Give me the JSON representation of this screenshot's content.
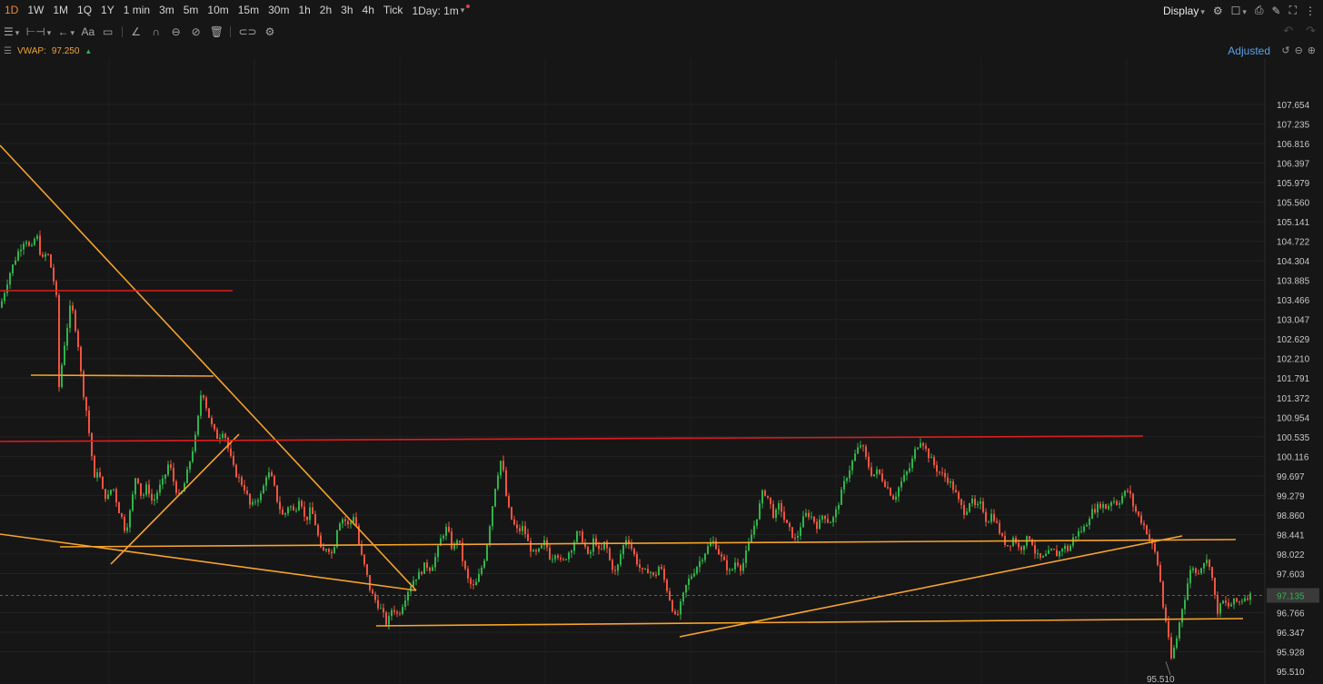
{
  "toolbar": {
    "timeframes": [
      "1D",
      "1W",
      "1M",
      "1Q",
      "1Y",
      "1 min",
      "3m",
      "5m",
      "10m",
      "15m",
      "30m",
      "1h",
      "2h",
      "3h",
      "4h",
      "Tick"
    ],
    "active_timeframe": "1D",
    "range_selector": "1Day: 1m",
    "display_label": "Display"
  },
  "drawing_tools": [
    "menu-icon",
    "measure-icon",
    "arrow-icon",
    "text-icon",
    "comment-icon",
    "line-icon",
    "magnet-icon",
    "ruler-icon",
    "eye-off-icon",
    "trash-icon",
    "link-icon",
    "settings-icon"
  ],
  "indicator": {
    "name": "VWAP:",
    "value": "97.250"
  },
  "price_mode": "Adjusted",
  "colors": {
    "up": "#2fb34a",
    "down": "#f0543e",
    "trend_orange": "#f6a32a",
    "resistance_red": "#e01c1c",
    "background": "#161616",
    "last_price": "#2fb34a"
  },
  "chart_data": {
    "type": "candlestick",
    "title": "",
    "xlabel": "",
    "ylabel": "",
    "ylim": [
      95.4,
      108.0
    ],
    "y_ticks": [
      "107.654",
      "107.235",
      "106.816",
      "106.397",
      "105.979",
      "105.560",
      "105.141",
      "104.722",
      "104.304",
      "103.885",
      "103.466",
      "103.047",
      "102.629",
      "102.210",
      "101.791",
      "101.372",
      "100.954",
      "100.535",
      "100.116",
      "99.697",
      "99.279",
      "98.860",
      "98.441",
      "98.022",
      "97.603",
      "97.135",
      "96.766",
      "96.347",
      "95.928",
      "95.510"
    ],
    "y_tick_values": [
      107.654,
      107.235,
      106.816,
      106.397,
      105.979,
      105.56,
      105.141,
      104.722,
      104.304,
      103.885,
      103.466,
      103.047,
      102.629,
      102.21,
      101.791,
      101.372,
      100.954,
      100.535,
      100.116,
      99.697,
      99.279,
      98.86,
      98.441,
      98.022,
      97.603,
      97.135,
      96.766,
      96.347,
      95.928,
      95.51
    ],
    "last_price": 97.135,
    "session_low": 95.51,
    "grid": true,
    "close_path": [
      [
        0,
        103.3
      ],
      [
        10,
        104.0
      ],
      [
        20,
        104.5
      ],
      [
        28,
        104.8
      ],
      [
        34,
        104.5
      ],
      [
        40,
        104.9
      ],
      [
        46,
        104.3
      ],
      [
        52,
        104.5
      ],
      [
        58,
        104.0
      ],
      [
        62,
        103.5
      ],
      [
        65,
        101.6
      ],
      [
        70,
        102.4
      ],
      [
        74,
        102.9
      ],
      [
        78,
        103.4
      ],
      [
        82,
        103.0
      ],
      [
        86,
        102.5
      ],
      [
        90,
        101.7
      ],
      [
        95,
        101.1
      ],
      [
        100,
        100.3
      ],
      [
        104,
        99.6
      ],
      [
        108,
        99.9
      ],
      [
        112,
        99.4
      ],
      [
        118,
        99.2
      ],
      [
        124,
        99.5
      ],
      [
        130,
        99.0
      ],
      [
        134,
        98.8
      ],
      [
        138,
        98.5
      ],
      [
        144,
        99.0
      ],
      [
        150,
        99.8
      ],
      [
        156,
        99.2
      ],
      [
        162,
        99.5
      ],
      [
        168,
        99.1
      ],
      [
        174,
        99.4
      ],
      [
        180,
        99.6
      ],
      [
        186,
        100.0
      ],
      [
        192,
        99.5
      ],
      [
        198,
        99.2
      ],
      [
        204,
        99.6
      ],
      [
        210,
        100.1
      ],
      [
        216,
        100.6
      ],
      [
        222,
        101.6
      ],
      [
        228,
        101.1
      ],
      [
        234,
        100.7
      ],
      [
        240,
        100.5
      ],
      [
        246,
        100.7
      ],
      [
        252,
        100.2
      ],
      [
        258,
        99.8
      ],
      [
        264,
        99.6
      ],
      [
        270,
        99.4
      ],
      [
        276,
        99.0
      ],
      [
        282,
        99.2
      ],
      [
        288,
        99.3
      ],
      [
        294,
        99.8
      ],
      [
        300,
        99.6
      ],
      [
        306,
        99.1
      ],
      [
        312,
        98.8
      ],
      [
        318,
        99.1
      ],
      [
        324,
        98.9
      ],
      [
        330,
        99.3
      ],
      [
        336,
        98.7
      ],
      [
        342,
        99.0
      ],
      [
        348,
        98.6
      ],
      [
        354,
        98.0
      ],
      [
        360,
        98.2
      ],
      [
        366,
        98.0
      ],
      [
        372,
        98.7
      ],
      [
        378,
        98.8
      ],
      [
        384,
        98.6
      ],
      [
        390,
        98.9
      ],
      [
        396,
        98.1
      ],
      [
        402,
        97.7
      ],
      [
        408,
        97.2
      ],
      [
        414,
        97.0
      ],
      [
        420,
        96.8
      ],
      [
        426,
        96.5
      ],
      [
        432,
        96.9
      ],
      [
        438,
        96.7
      ],
      [
        444,
        97.0
      ],
      [
        450,
        97.3
      ],
      [
        456,
        97.5
      ],
      [
        462,
        97.6
      ],
      [
        468,
        97.8
      ],
      [
        474,
        97.7
      ],
      [
        480,
        98.0
      ],
      [
        486,
        98.4
      ],
      [
        492,
        98.6
      ],
      [
        498,
        98.1
      ],
      [
        504,
        98.4
      ],
      [
        510,
        97.8
      ],
      [
        516,
        97.4
      ],
      [
        522,
        97.3
      ],
      [
        528,
        97.6
      ],
      [
        534,
        98.0
      ],
      [
        540,
        98.8
      ],
      [
        546,
        99.6
      ],
      [
        552,
        100.1
      ],
      [
        558,
        99.1
      ],
      [
        564,
        98.7
      ],
      [
        570,
        98.5
      ],
      [
        576,
        98.6
      ],
      [
        582,
        98.2
      ],
      [
        588,
        98.0
      ],
      [
        594,
        98.1
      ],
      [
        600,
        98.3
      ],
      [
        606,
        97.9
      ],
      [
        612,
        98.1
      ],
      [
        618,
        97.8
      ],
      [
        624,
        98.0
      ],
      [
        630,
        98.2
      ],
      [
        636,
        98.5
      ],
      [
        642,
        98.3
      ],
      [
        648,
        97.9
      ],
      [
        654,
        98.4
      ],
      [
        660,
        98.0
      ],
      [
        666,
        98.3
      ],
      [
        672,
        97.8
      ],
      [
        678,
        97.6
      ],
      [
        684,
        98.1
      ],
      [
        690,
        98.4
      ],
      [
        696,
        98.1
      ],
      [
        702,
        97.8
      ],
      [
        708,
        97.6
      ],
      [
        714,
        97.7
      ],
      [
        720,
        97.5
      ],
      [
        726,
        97.8
      ],
      [
        732,
        97.4
      ],
      [
        738,
        97.0
      ],
      [
        744,
        96.6
      ],
      [
        750,
        97.0
      ],
      [
        756,
        97.4
      ],
      [
        762,
        97.6
      ],
      [
        768,
        97.8
      ],
      [
        774,
        98.0
      ],
      [
        780,
        98.2
      ],
      [
        786,
        98.3
      ],
      [
        792,
        98.0
      ],
      [
        798,
        97.8
      ],
      [
        804,
        97.6
      ],
      [
        810,
        97.9
      ],
      [
        816,
        97.7
      ],
      [
        822,
        98.1
      ],
      [
        828,
        98.5
      ],
      [
        834,
        98.9
      ],
      [
        840,
        99.4
      ],
      [
        846,
        99.2
      ],
      [
        852,
        98.8
      ],
      [
        858,
        99.1
      ],
      [
        864,
        98.7
      ],
      [
        870,
        98.5
      ],
      [
        876,
        98.3
      ],
      [
        882,
        98.7
      ],
      [
        888,
        98.9
      ],
      [
        894,
        98.8
      ],
      [
        900,
        98.6
      ],
      [
        906,
        98.9
      ],
      [
        912,
        98.7
      ],
      [
        918,
        98.8
      ],
      [
        924,
        99.2
      ],
      [
        930,
        99.6
      ],
      [
        936,
        99.9
      ],
      [
        942,
        100.2
      ],
      [
        948,
        100.4
      ],
      [
        954,
        100.0
      ],
      [
        960,
        99.7
      ],
      [
        966,
        99.8
      ],
      [
        972,
        99.6
      ],
      [
        978,
        99.4
      ],
      [
        984,
        99.2
      ],
      [
        990,
        99.5
      ],
      [
        996,
        99.7
      ],
      [
        1002,
        99.9
      ],
      [
        1008,
        100.3
      ],
      [
        1014,
        100.5
      ],
      [
        1020,
        100.2
      ],
      [
        1026,
        100.0
      ],
      [
        1032,
        99.8
      ],
      [
        1038,
        99.7
      ],
      [
        1044,
        99.6
      ],
      [
        1050,
        99.4
      ],
      [
        1056,
        99.1
      ],
      [
        1062,
        98.9
      ],
      [
        1068,
        99.2
      ],
      [
        1074,
        99.0
      ],
      [
        1080,
        99.1
      ],
      [
        1086,
        98.7
      ],
      [
        1092,
        98.9
      ],
      [
        1098,
        98.6
      ],
      [
        1104,
        98.3
      ],
      [
        1110,
        98.2
      ],
      [
        1116,
        98.4
      ],
      [
        1122,
        98.1
      ],
      [
        1128,
        98.3
      ],
      [
        1134,
        98.4
      ],
      [
        1140,
        98.0
      ],
      [
        1146,
        97.9
      ],
      [
        1152,
        98.0
      ],
      [
        1158,
        98.1
      ],
      [
        1164,
        98.0
      ],
      [
        1170,
        98.2
      ],
      [
        1176,
        98.1
      ],
      [
        1182,
        98.4
      ],
      [
        1188,
        98.5
      ],
      [
        1194,
        98.6
      ],
      [
        1200,
        98.9
      ],
      [
        1206,
        99.0
      ],
      [
        1212,
        99.1
      ],
      [
        1218,
        99.0
      ],
      [
        1224,
        99.2
      ],
      [
        1230,
        99.1
      ],
      [
        1236,
        99.3
      ],
      [
        1242,
        99.4
      ],
      [
        1248,
        99.0
      ],
      [
        1254,
        98.8
      ],
      [
        1260,
        98.6
      ],
      [
        1266,
        98.3
      ],
      [
        1272,
        98.0
      ],
      [
        1276,
        97.6
      ],
      [
        1280,
        96.9
      ],
      [
        1285,
        96.4
      ],
      [
        1288,
        95.7
      ],
      [
        1292,
        96.0
      ],
      [
        1296,
        96.3
      ],
      [
        1300,
        96.8
      ],
      [
        1304,
        97.1
      ],
      [
        1308,
        97.5
      ],
      [
        1312,
        97.8
      ],
      [
        1316,
        97.6
      ],
      [
        1320,
        97.7
      ],
      [
        1326,
        97.9
      ],
      [
        1332,
        97.8
      ],
      [
        1336,
        97.2
      ],
      [
        1340,
        96.8
      ],
      [
        1346,
        97.0
      ],
      [
        1352,
        96.9
      ],
      [
        1358,
        97.0
      ],
      [
        1364,
        97.0
      ],
      [
        1370,
        97.1
      ],
      [
        1376,
        97.135
      ]
    ]
  }
}
